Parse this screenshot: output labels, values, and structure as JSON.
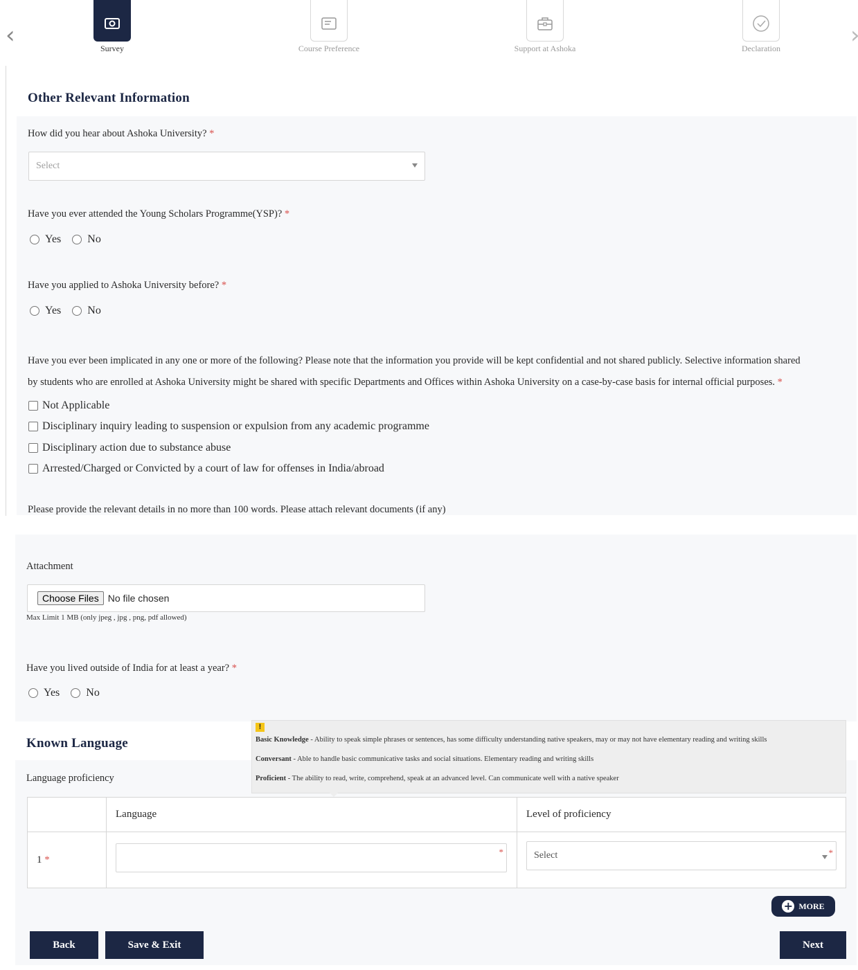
{
  "stepper": {
    "steps": [
      {
        "label": "Survey",
        "icon": "banknote-icon",
        "active": true
      },
      {
        "label": "Course Preference",
        "icon": "document-icon",
        "active": false
      },
      {
        "label": "Support at Ashoka",
        "icon": "briefcase-icon",
        "active": false
      },
      {
        "label": "Declaration",
        "icon": "check-circle-icon",
        "active": false
      }
    ]
  },
  "other_info": {
    "title": "Other Relevant Information",
    "q_hear": {
      "label": "How did you hear about Ashoka University?",
      "required": "*",
      "placeholder": "Select"
    },
    "q_ysp": {
      "label": "Have you ever attended the Young Scholars Programme(YSP)?",
      "required": "*",
      "options": [
        "Yes",
        "No"
      ]
    },
    "q_applied": {
      "label": "Have you applied to Ashoka University before?",
      "required": "*",
      "options": [
        "Yes",
        "No"
      ]
    },
    "q_implicated": {
      "line1": "Have you ever been implicated in any one or more of the following? Please note that the information you provide will be kept confidential and not shared publicly. Selective information shared",
      "line2": "by students who are enrolled at Ashoka University might be shared with specific Departments and Offices within Ashoka University on a case-by-case basis for internal official purposes.",
      "required": "*",
      "options": [
        "Not Applicable",
        "Disciplinary inquiry leading to suspension or expulsion from any academic programme",
        "Disciplinary action due to substance abuse",
        "Arrested/Charged or Convicted by a court of law for offenses in India/abroad"
      ]
    },
    "details_note": "Please provide the relevant details in no more than 100 words. Please attach relevant documents (if any)",
    "attachment": {
      "label": "Attachment",
      "button": "Choose Files",
      "status": "No file chosen",
      "hint": "Max Limit 1 MB (only jpeg , jpg , png, pdf allowed)"
    },
    "q_outside": {
      "label": "Have you lived outside of India for at least a year?",
      "required": "*",
      "options": [
        "Yes",
        "No"
      ]
    }
  },
  "tooltip": {
    "icon": "!",
    "items": [
      {
        "term": "Basic Knowledge",
        "desc": " - Ability to speak simple phrases or sentences, has some difficulty understanding native speakers, may or may not have elementary reading and writing skills"
      },
      {
        "term": "Conversant",
        "desc": " - Able to handle basic communicative tasks and social situations. Elementary reading and writing skills"
      },
      {
        "term": "Proficient",
        "desc": " - The ability to read, write, comprehend, speak at an advanced level. Can communicate well with a native speaker"
      }
    ]
  },
  "languages": {
    "title": "Known Language",
    "subtitle": "Language proficiency",
    "headers": [
      "",
      "Language",
      "Level of proficiency"
    ],
    "rows": [
      {
        "index": "1",
        "required": "*",
        "language": "",
        "level_placeholder": "Select"
      }
    ],
    "more_label": "MORE"
  },
  "footer": {
    "back": "Back",
    "save_exit": "Save & Exit",
    "next": "Next"
  }
}
